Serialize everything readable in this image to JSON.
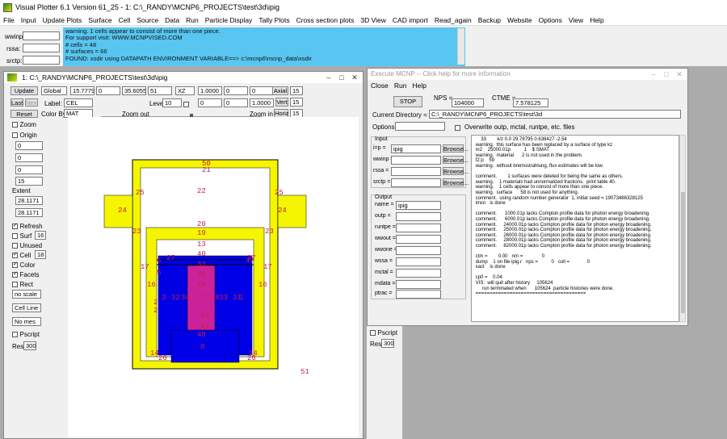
{
  "app": {
    "title": "Visual Plotter 6.1 Version 61_25  - 1:  C:\\_RANDY\\MCNP6_PROJECTS\\test\\3d\\ipig"
  },
  "menu": [
    "File",
    "Input",
    "Update Plots",
    "Surface",
    "Cell",
    "Source",
    "Data",
    "Run",
    "Particle Display",
    "Tally Plots",
    "Cross section plots",
    "3D View",
    "CAD import",
    "Read_again",
    "Backup",
    "Website",
    "Options",
    "View",
    "Help"
  ],
  "top": {
    "wwinp_label": "wwinp:",
    "rssa_label": "rssa:",
    "srctp_label": "srctp:",
    "messages": [
      "warning.    1 cells appear to consist of more than one piece.",
      "For support visit: WWW.MCNPVISED.COM",
      "# cells = 48",
      "# surfaces = 66",
      "FOUND: xsdir using DATAPATH ENVIRONMENT VARIABLE==>  c:\\mcnp6\\mcnp_data\\xsdir"
    ]
  },
  "plot": {
    "title": "1:  C:\\_RANDY\\MCNP6_PROJECTS\\test\\3d\\ipig",
    "update": "Update",
    "last": "Last",
    "next": "Next",
    "reset": "Reset",
    "global": "Global",
    "origin_x": "15.7779",
    "origin_y": "0",
    "origin_z": "35.6055",
    "extent_val": "51",
    "plane": "XZ",
    "dir1": [
      "1.0000",
      "0",
      "0"
    ],
    "dir2": [
      "0",
      "0",
      "1.0000"
    ],
    "axial_label": "Axial",
    "axial_val": "15",
    "vert_label": "Vert",
    "vert_val": "15",
    "horiz_label": "Horiz",
    "horiz_val": "15",
    "label_label": "Label:",
    "label_val": "CEL",
    "level_label": "Level",
    "level_val": "10",
    "colorby_label": "Color By:",
    "colorby_val": "MAT",
    "zoomout": "Zoom out",
    "zoomin": "Zoom in",
    "left_checks": [
      {
        "label": "Zoom",
        "on": false
      },
      {
        "label": "Origin",
        "on": false
      }
    ],
    "left_values": [
      "0",
      "0",
      "0",
      "15"
    ],
    "extent_label": "Extent",
    "extent_vals": [
      "28.1171",
      "28.1171"
    ],
    "opts": [
      {
        "label": "Refresh",
        "on": true
      },
      {
        "label": "Surf",
        "on": false,
        "val": "16"
      },
      {
        "label": "Unused",
        "on": false
      },
      {
        "label": "Cell",
        "on": true,
        "val": "18"
      },
      {
        "label": "Color",
        "on": true
      },
      {
        "label": "Facets",
        "on": true
      },
      {
        "label": "Rect",
        "on": false
      }
    ],
    "selects": [
      "no scale",
      "Cell Line",
      "No mes"
    ],
    "pscript": "Pscript",
    "res_label": "Res",
    "res_val": "300",
    "cell_labels": [
      "50",
      "21",
      "22",
      "25",
      "25",
      "24",
      "24",
      "23",
      "23",
      "20",
      "19",
      "13",
      "6",
      "27",
      "40",
      "27",
      "47",
      "5",
      "33",
      "36",
      "17",
      "17",
      "15",
      "16",
      "16",
      "2",
      "3",
      "32",
      "34",
      "7",
      "833",
      "31",
      "1",
      "2",
      "48",
      "14",
      "14",
      "26",
      "26",
      "51",
      "8",
      "43",
      "23"
    ]
  },
  "exec": {
    "title": "Execute MCNP -- Click help for more information",
    "menu": [
      "Close",
      "Run",
      "Help"
    ],
    "stop": "STOP",
    "nps_label": "NPS =",
    "nps_val": "104000",
    "ctme_label": "CTME =",
    "ctme_val": "7.578125",
    "curdir_label": "Current Directory =",
    "curdir_val": "C:\\_RANDY\\MCNP6_PROJECTS\\test\\3d",
    "options_label": "Options =",
    "overwrite": "Overwrite outp, mctal, runtpe, etc. files",
    "input_title": "Input",
    "inputs": [
      {
        "label": "i=p =",
        "val": "ipig"
      },
      {
        "label": "wwinp =",
        "val": ""
      },
      {
        "label": "rssa =",
        "val": ""
      },
      {
        "label": "srctp =",
        "val": ""
      }
    ],
    "browse": "Browse...",
    "output_title": "Output",
    "outputs": [
      {
        "label": "name =",
        "val": "ipig"
      },
      {
        "label": "outp =",
        "val": ""
      },
      {
        "label": "runtpe =",
        "val": ""
      },
      {
        "label": "wwout =",
        "val": ""
      },
      {
        "label": "wwone =",
        "val": ""
      },
      {
        "label": "wssa =",
        "val": ""
      },
      {
        "label": "mctal =",
        "val": ""
      },
      {
        "label": "mdata =",
        "val": ""
      },
      {
        "label": "ptrac =",
        "val": ""
      }
    ],
    "log": [
      "     33        k/z 0.0 29.78795 0.638427 -2.54",
      " warning.  this surface has been replaced by a surface of type kz",
      " m2    25000.01p          1    $ SMAT",
      " warning.  material      2 is not used in the problem.",
      " f2:p    59",
      " warning.  without bremsstrahlung, flux estimates will be low.",
      "",
      " comment.        1 surfaces were deleted for being the same as others.",
      " warning.    1 materials had unnormalized fractions.  print table 40.",
      " warning.    1 cells appear to consist of more than one piece.",
      " warning.  surface      58 is not used for anything.",
      " comment.  using random number generator  1, initial seed = 19073486328125",
      " imcn   is done",
      "",
      " comment.      1000.01p lacks Compton profile data for photon energy broadening.",
      " comment.      6000.01p lacks Compton profile data for photon energy broadening.",
      " comment.     24000.01p lacks Compton profile data for photon energy broadening.",
      " comment.     25000.01p lacks Compton profile data for photon energy broadening.",
      " comment.     26000.01p lacks Compton profile data for photon energy broadening.",
      " comment.     28000.01p lacks Compton profile data for photon energy broadening.",
      " comment.     82000.01p lacks Compton profile data for photon energy broadening.",
      "",
      " ctm =        0.00   nrn =              0",
      " dump    1 on file ipig.r   nps =          0   coll =             0",
      " xact    is done",
      "",
      " cp0 =    0.04",
      " VIS:  will quit after history     105624",
      "      run terminated when      105624  particle histories were done.",
      " ======================================="
    ]
  },
  "colors": {
    "yellow": "#f5f500",
    "blue": "#0000e6",
    "magenta": "#cc2299",
    "msg": "#58c6f0",
    "labelred": "#c0204a"
  }
}
